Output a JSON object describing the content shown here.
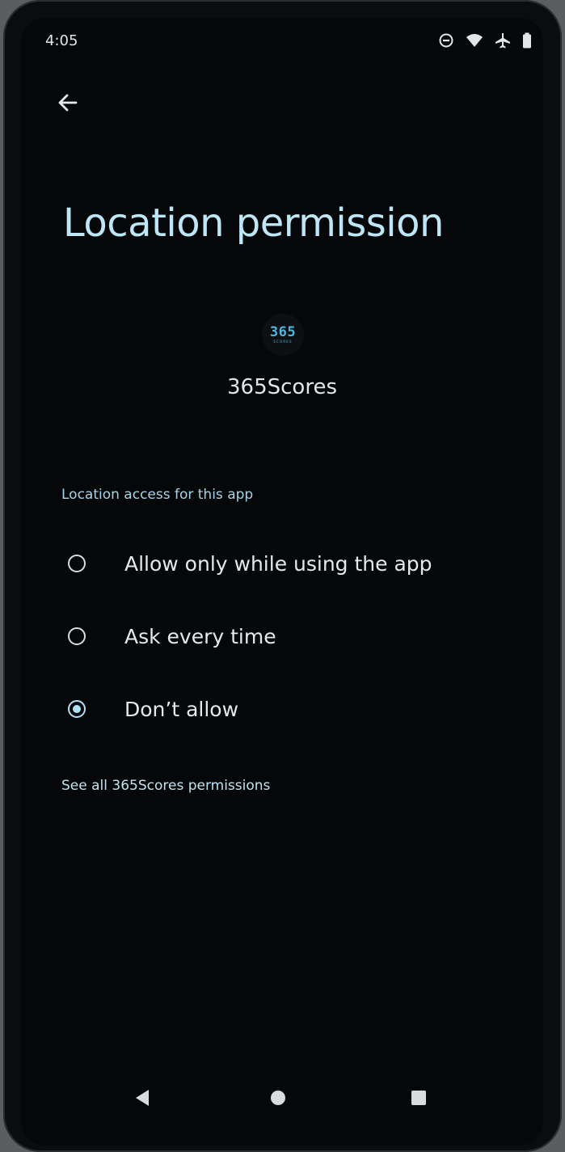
{
  "status_bar": {
    "time": "4:05",
    "icons": [
      "do-not-disturb-icon",
      "wifi-icon",
      "airplane-mode-icon",
      "battery-icon"
    ]
  },
  "header": {
    "back_icon": "arrow-left-icon",
    "title": "Location permission"
  },
  "app": {
    "icon_logo_text": "365",
    "icon_sub_text": "SCORES",
    "name": "365Scores"
  },
  "section": {
    "label": "Location access for this app"
  },
  "options": [
    {
      "label": "Allow only while using the app",
      "selected": false
    },
    {
      "label": "Ask every time",
      "selected": false
    },
    {
      "label": "Don’t allow",
      "selected": true
    }
  ],
  "link": {
    "label": "See all 365Scores permissions"
  },
  "navbar": {
    "back_icon": "triangle-back-icon",
    "home_icon": "circle-home-icon",
    "recents_icon": "square-recents-icon"
  },
  "colors": {
    "accent": "#aee2f7",
    "title": "#bde6f6",
    "background": "#060708"
  }
}
